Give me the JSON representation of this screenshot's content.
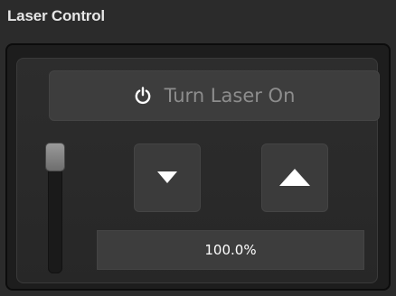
{
  "panel": {
    "title": "Laser Control"
  },
  "laser_button": {
    "label": "Turn Laser On",
    "icon": "power-icon"
  },
  "power_slider": {
    "level": 1.0
  },
  "decrease_button": {
    "icon": "triangle-down-icon"
  },
  "increase_button": {
    "icon": "triangle-up-icon"
  },
  "power_readout": {
    "value": "100.0%"
  },
  "colors": {
    "background": "#2b2b2b",
    "panel": "#1d1d1d",
    "button": "#3d3d3d",
    "muted_text": "#8d8d8d",
    "bright_text": "#ffffff"
  }
}
